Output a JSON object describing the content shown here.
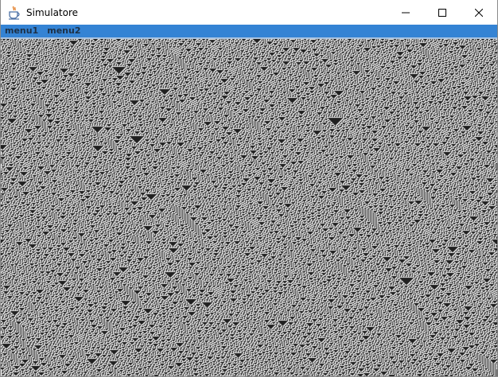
{
  "window": {
    "title": "Simulatore",
    "icon": "java-cup-icon",
    "controls": {
      "minimize_icon": "minimize-icon",
      "maximize_icon": "maximize-icon",
      "close_icon": "close-icon"
    }
  },
  "menubar": {
    "items": [
      {
        "label": "menu1"
      },
      {
        "label": "menu2"
      }
    ],
    "background": "#3483d4"
  },
  "simulation": {
    "type": "elementary cellular automaton",
    "cell_colors": {
      "alive": "#ffffff",
      "dead": "#202020"
    }
  }
}
